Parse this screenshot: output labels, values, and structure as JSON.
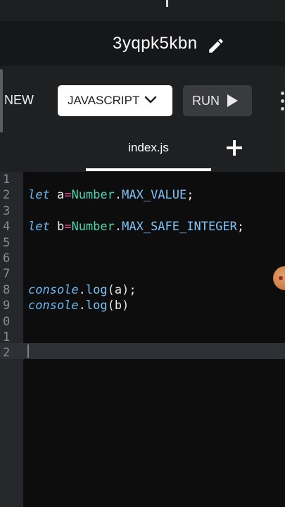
{
  "project": {
    "name": "3yqpk5kbn"
  },
  "toolbar": {
    "new_label": "NEW",
    "language": "JAVASCRIPT",
    "run_label": "RUN"
  },
  "tabs": [
    {
      "label": "index.js",
      "active": true
    }
  ],
  "editor": {
    "line_numbers": [
      "1",
      "2",
      "3",
      "4",
      "5",
      "6",
      "7",
      "8",
      "9",
      "0",
      "1",
      "2"
    ],
    "lines": [
      {
        "tokens": []
      },
      {
        "tokens": [
          {
            "t": "let",
            "c": "kw"
          },
          {
            "t": " a",
            "c": "fn"
          },
          {
            "t": "=",
            "c": "op"
          },
          {
            "t": "Number",
            "c": "cls"
          },
          {
            "t": ".",
            "c": "fn"
          },
          {
            "t": "MAX_VALUE",
            "c": "prop"
          },
          {
            "t": ";",
            "c": "fn"
          }
        ]
      },
      {
        "tokens": []
      },
      {
        "tokens": [
          {
            "t": "let",
            "c": "kw"
          },
          {
            "t": " b",
            "c": "fn"
          },
          {
            "t": "=",
            "c": "op"
          },
          {
            "t": "Number",
            "c": "cls"
          },
          {
            "t": ".",
            "c": "fn"
          },
          {
            "t": "MAX_SAFE_INTEGER",
            "c": "prop"
          },
          {
            "t": ";",
            "c": "fn"
          }
        ]
      },
      {
        "tokens": []
      },
      {
        "tokens": []
      },
      {
        "tokens": []
      },
      {
        "tokens": [
          {
            "t": "console",
            "c": "kw"
          },
          {
            "t": ".",
            "c": "fn"
          },
          {
            "t": "log",
            "c": "prop"
          },
          {
            "t": "(a);",
            "c": "fn"
          }
        ]
      },
      {
        "tokens": [
          {
            "t": "console",
            "c": "kw"
          },
          {
            "t": ".",
            "c": "fn"
          },
          {
            "t": "log",
            "c": "prop"
          },
          {
            "t": "(b)",
            "c": "fn"
          }
        ]
      },
      {
        "tokens": []
      },
      {
        "tokens": []
      },
      {
        "tokens": []
      }
    ]
  },
  "colors": {
    "keyword": "#6ab7f2",
    "operator": "#f14c9a",
    "class": "#4fd6b0",
    "property": "#7fc4f8",
    "accent": "#ffffff"
  },
  "icons": {
    "edit": "pencil-icon",
    "language_dropdown": "chevron-down-icon",
    "run": "play-icon",
    "add": "plus-icon"
  }
}
